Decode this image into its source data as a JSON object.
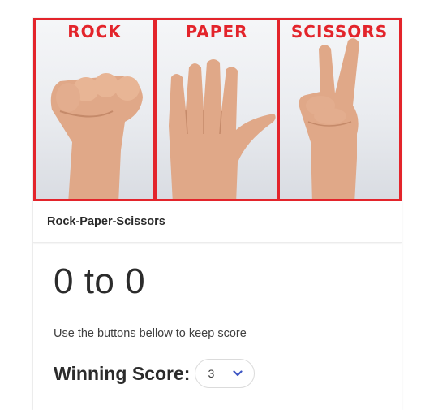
{
  "hero": {
    "panels": [
      {
        "label": "ROCK"
      },
      {
        "label": "PAPER"
      },
      {
        "label": "SCISSORS"
      }
    ]
  },
  "card": {
    "title": "Rock-Paper-Scissors",
    "score_text": "0 to 0",
    "help_text": "Use the buttons bellow to keep score",
    "winning_label": "Winning Score:",
    "winning_value": "3"
  },
  "colors": {
    "accent_red": "#e3242b",
    "chevron_blue": "#3e56c4"
  },
  "icons": [
    "chevron-down-icon"
  ]
}
